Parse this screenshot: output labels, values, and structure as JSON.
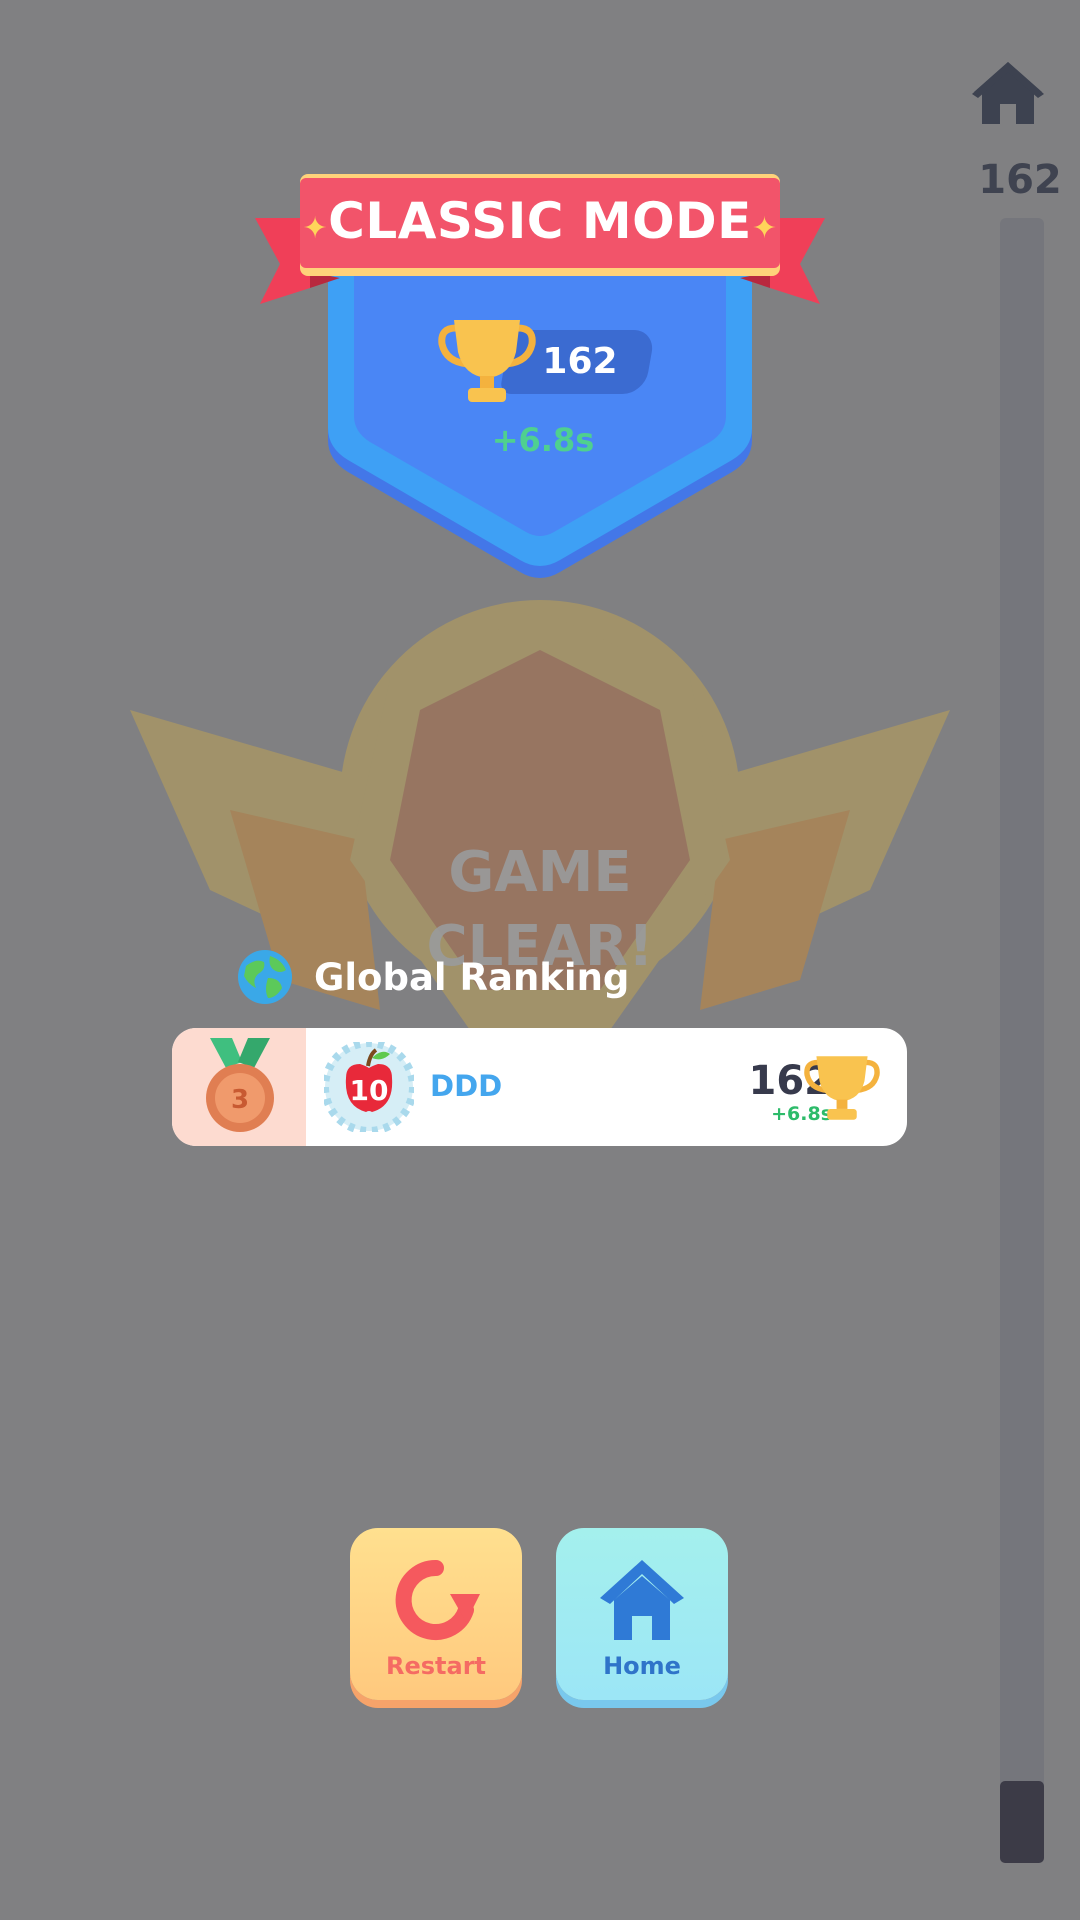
{
  "header": {
    "home_icon": "home-icon",
    "score": "162",
    "progress_fraction": 0.05
  },
  "result_card": {
    "mode_title": "CLASSIC MODE",
    "score": "162",
    "time_bonus": "+6.8s",
    "trophy_icon": "trophy-icon"
  },
  "emblem": {
    "line1": "GAME",
    "line2": "CLEAR!"
  },
  "ranking": {
    "title": "Global Ranking",
    "globe_icon": "globe-icon",
    "entry": {
      "rank": "3",
      "avatar_level": "10",
      "name": "DDD",
      "score": "162",
      "time_bonus": "+6.8s"
    }
  },
  "buttons": {
    "restart_label": "Restart",
    "home_label": "Home"
  },
  "colors": {
    "background": "#808082",
    "banner": "#f2546a",
    "shield": "#4a86f5",
    "bonus_green": "#4fd08f",
    "name_blue": "#44a6ee"
  }
}
